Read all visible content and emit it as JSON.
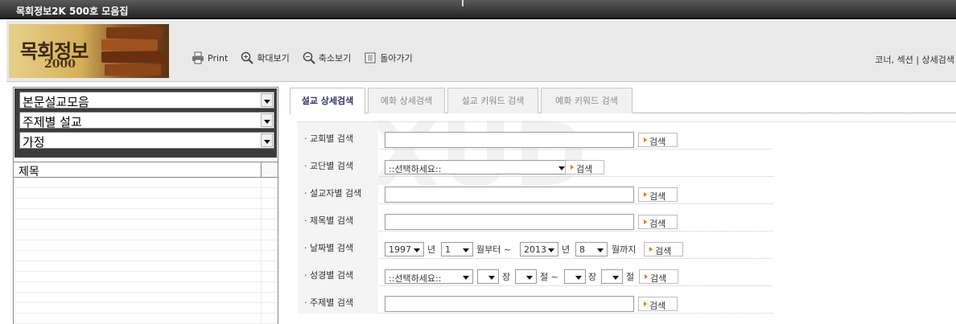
{
  "window": {
    "title": "목회정보2K 500호 모음집"
  },
  "header": {
    "logo_text": "목회정보",
    "logo_sub": "2000",
    "toolbar": [
      {
        "label": "Print",
        "icon": "printer-icon"
      },
      {
        "label": "확대보기",
        "icon": "zoom-in-icon"
      },
      {
        "label": "축소보기",
        "icon": "zoom-out-icon"
      },
      {
        "label": "돌아가기",
        "icon": "back-icon"
      }
    ],
    "right_nav": "코너, 섹션  |  상세검색"
  },
  "sidebar": {
    "selects": [
      "본문설교모음",
      "주제별 설교",
      "가정"
    ],
    "list_header": "제목"
  },
  "tabs": [
    {
      "label": "설교 상세검색",
      "active": true
    },
    {
      "label": "예화 상세검색",
      "active": false
    },
    {
      "label": "설교 키워드 검색",
      "active": false
    },
    {
      "label": "예화 키워드 검색",
      "active": false
    }
  ],
  "watermark": "XUD",
  "form": {
    "search_label": "검색",
    "rows": [
      {
        "label": "· 교회별 검색"
      },
      {
        "label": "· 교단별 검색",
        "select": "::선택하세요::"
      },
      {
        "label": "· 설교자별 검색"
      },
      {
        "label": "· 제목별 검색"
      },
      {
        "label": "· 날짜별 검색",
        "year_from": "1997",
        "month_from": "1",
        "year_to": "2013",
        "month_to": "8",
        "t_year": "년",
        "t_from": "월부터 ~",
        "t_to": "월까지"
      },
      {
        "label": "· 성경별 검색",
        "select": "::선택하세요::",
        "t_jang": "장",
        "t_jeol": "절 ~",
        "t_jang2": "장",
        "t_jeol2": "절"
      },
      {
        "label": "· 주제별 검색"
      }
    ]
  }
}
